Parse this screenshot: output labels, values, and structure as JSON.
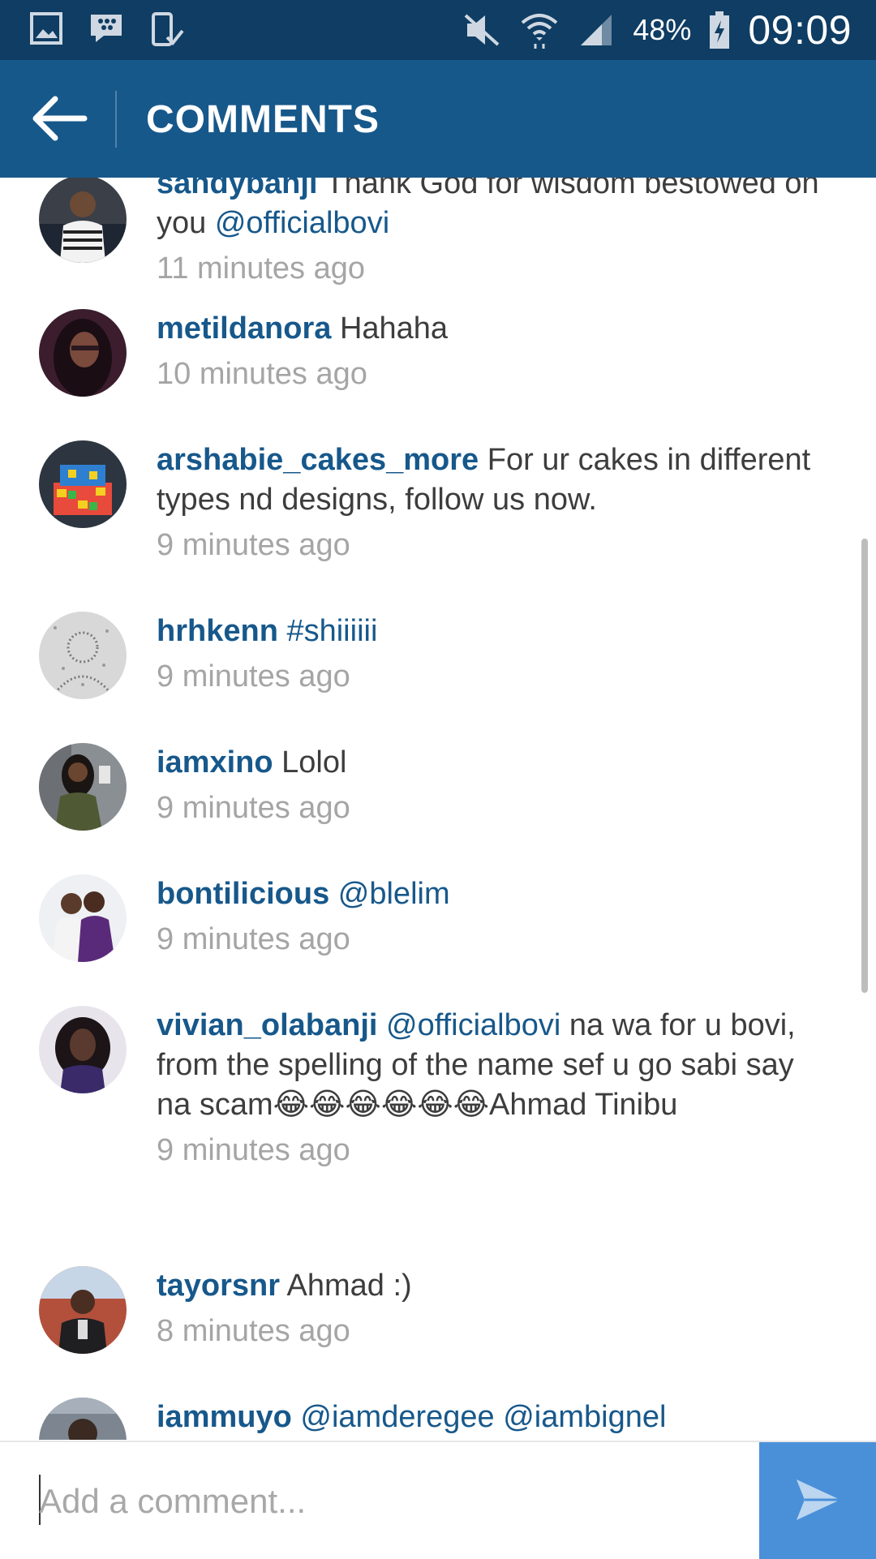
{
  "status_bar": {
    "battery_percent": "48%",
    "time": "09:09",
    "icons": [
      "image-icon",
      "blackberry-messenger-icon",
      "device-check-icon",
      "mute-icon",
      "wifi-icon",
      "signal-icon",
      "battery-charging-icon"
    ]
  },
  "header": {
    "title": "COMMENTS",
    "back_icon": "arrow-left-icon"
  },
  "comments": [
    {
      "username": "sandybanji",
      "text": " Thank God for wisdom bestowed on you ",
      "mention": "@officialbovi",
      "text_after": "",
      "time": "11 minutes ago"
    },
    {
      "username": "metildanora",
      "text": " Hahaha",
      "mention": "",
      "text_after": "",
      "time": "10 minutes ago"
    },
    {
      "username": "arshabie_cakes_more",
      "text": " For ur cakes in different types nd designs, follow us now.",
      "mention": "",
      "text_after": "",
      "time": "9 minutes ago"
    },
    {
      "username": "hrhkenn",
      "text": " ",
      "mention": "#shiiiiii",
      "text_after": "",
      "time": "9 minutes ago"
    },
    {
      "username": "iamxino",
      "text": " Lolol",
      "mention": "",
      "text_after": "",
      "time": "9 minutes ago"
    },
    {
      "username": "bontilicious",
      "text": " ",
      "mention": "@blelim",
      "text_after": "",
      "time": "9 minutes ago"
    },
    {
      "username": "vivian_olabanji",
      "text": " ",
      "mention": "@officialbovi",
      "text_after": " na wa for u bovi, from the spelling of the name sef u go sabi say na scam😂😂😂😂😂😂Ahmad Tinibu",
      "time": "9 minutes ago"
    },
    {
      "username": "tayorsnr",
      "text": " Ahmad :)",
      "mention": "",
      "text_after": "",
      "time": "8 minutes ago"
    },
    {
      "username": "iammuyo",
      "text": " ",
      "mention": "@iamderegee @iambignel",
      "text_after": "",
      "time": ""
    }
  ],
  "composer": {
    "placeholder": "Add a comment...",
    "send_icon": "send-icon"
  },
  "colors": {
    "status_bar": "#0f3d63",
    "app_bar": "#17588b",
    "username": "#17588b",
    "timestamp": "#a5a5a5",
    "send_button": "#4a90d9"
  }
}
